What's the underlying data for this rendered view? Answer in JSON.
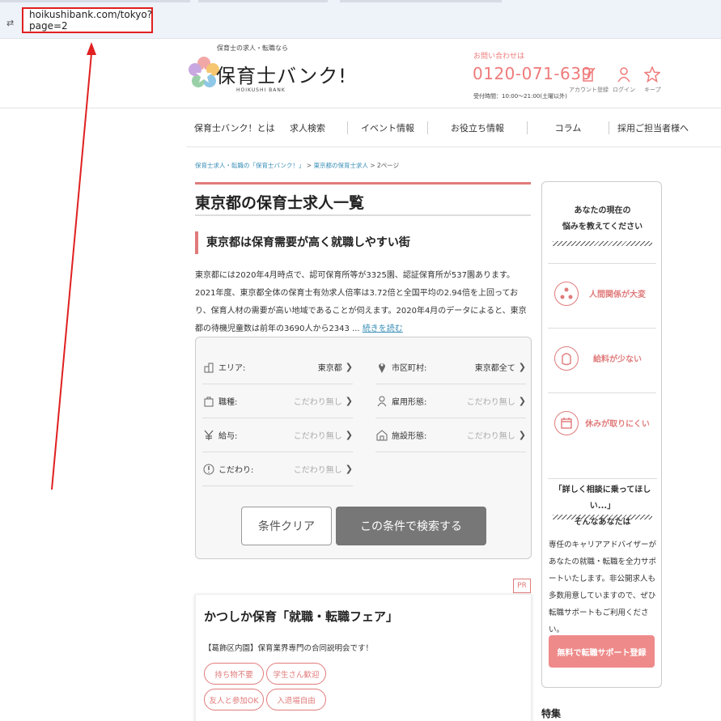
{
  "browser": {
    "url": "hoikushibank.com/tokyo?page=2",
    "left_glyph": "⇄"
  },
  "header": {
    "tagline": "保育士の求人・転職なら",
    "logo_text": "保育士バンク!",
    "logo_sub": "HOIKUSHI BANK",
    "contact_label": "お問い合わせは",
    "phone": "0120-071-639",
    "hours": "受付時間：10:00〜21:00(土曜以外)",
    "icons": [
      {
        "label": "アカウント登録",
        "icon": "edit-icon"
      },
      {
        "label": "ログイン",
        "icon": "person-icon"
      },
      {
        "label": "キープ",
        "icon": "star-icon"
      }
    ]
  },
  "nav": [
    "保育士バンク！とは",
    "求人検索",
    "イベント情報",
    "お役立ち情報",
    "コラム",
    "採用ご担当者様へ"
  ],
  "breadcrumb": {
    "home": "保育士求人・転職の「保育士バンク！」",
    "area": "東京都の保育士求人",
    "current": "2ページ",
    "separator": ">"
  },
  "main": {
    "title": "東京都の保育士求人一覧",
    "section_title": "東京都は保育需要が高く就職しやすい街",
    "intro": "東京都には2020年4月時点で、認可保育所等が3325園、認証保育所が537園あります。2021年度、東京都全体の保育士有効求人倍率は3.72倍と全国平均の2.94倍を上回っており、保育人材の需要が高い地域であることが伺えます。2020年4月のデータによると、東京都の待機児童数は前年の3690人から2343 ...",
    "read_more": "続きを読む"
  },
  "search": {
    "fields": [
      {
        "label": "エリア:",
        "value": "東京都",
        "empty": false,
        "icon": "area-icon"
      },
      {
        "label": "市区町村:",
        "value": "東京都全て",
        "empty": false,
        "icon": "pin-icon"
      },
      {
        "label": "職種:",
        "value": "こだわり無し",
        "empty": true,
        "icon": "bag-icon"
      },
      {
        "label": "雇用形態:",
        "value": "こだわり無し",
        "empty": true,
        "icon": "user-icon"
      },
      {
        "label": "給与:",
        "value": "こだわり無し",
        "empty": true,
        "icon": "yen-icon"
      },
      {
        "label": "施設形態:",
        "value": "こだわり無し",
        "empty": true,
        "icon": "building-icon"
      },
      {
        "label": "こだわり:",
        "value": "こだわり無し",
        "empty": true,
        "icon": "exclaim-icon"
      }
    ],
    "chevron": "❯",
    "clear_label": "条件クリア",
    "search_label": "この条件で検索する"
  },
  "job_card": {
    "pr": "PR",
    "title": "かつしか保育「就職・転職フェア」",
    "desc": "【葛飾区内園】保育業界専門の合同説明会です！",
    "tags": [
      "持ち物不要",
      "学生さん歓迎",
      "友人と参加OK",
      "入退場自由"
    ]
  },
  "sidebar": {
    "heading1": [
      "あなたの現在の",
      "悩みを教えてください"
    ],
    "items": [
      {
        "label": "人間関係が大変",
        "icon": "people-icon"
      },
      {
        "label": "給料が少ない",
        "icon": "wallet-icon"
      },
      {
        "label": "休みが取りにくい",
        "icon": "calendar-icon"
      }
    ],
    "heading2": [
      "「詳しく相談に乗ってほしい...」",
      "そんなあなたは"
    ],
    "body": "専任のキャリアアドバイザーがあなたの就職・転職を全力サポートいたします。非公開求人も多数用意していますので、ぜひ転職サポートもご利用ください。",
    "cta": "無料で転職サポート登録"
  },
  "feature_label": "特集",
  "colors": {
    "accent": "#e07b7b",
    "link": "#3a8fb7",
    "annotation": "#e02020"
  }
}
